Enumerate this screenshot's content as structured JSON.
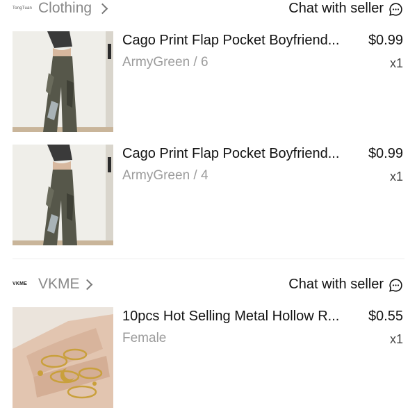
{
  "stores": [
    {
      "logo_text": "TongTuan",
      "name": "Clothing",
      "chat_label": "Chat with seller",
      "items": [
        {
          "title": "Cago Print Flap Pocket Boyfriend...",
          "price": "$0.99",
          "variant": "ArmyGreen / 6",
          "qty": "x1",
          "thumb": "cargo-pants-photo"
        },
        {
          "title": "Cago Print Flap Pocket Boyfriend...",
          "price": "$0.99",
          "variant": "ArmyGreen / 4",
          "qty": "x1",
          "thumb": "cargo-pants-photo"
        }
      ]
    },
    {
      "logo_text": "VKME",
      "name": "VKME",
      "chat_label": "Chat with seller",
      "items": [
        {
          "title": "10pcs Hot Selling Metal Hollow R...",
          "price": "$0.55",
          "variant": "Female",
          "qty": "x1",
          "thumb": "gold-rings-photo"
        }
      ]
    }
  ],
  "colors": {
    "text": "#111111",
    "muted": "#9b9b9b",
    "store_name": "#888888",
    "divider": "#ececec"
  }
}
